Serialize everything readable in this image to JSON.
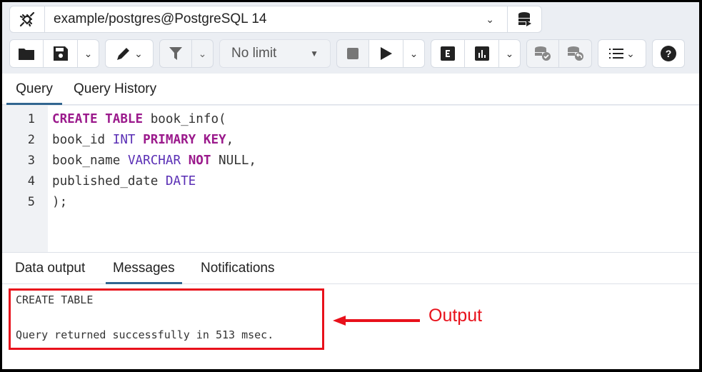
{
  "connection": {
    "label": "example/postgres@PostgreSQL 14",
    "icons": {
      "connection": "plug-disconnect-icon",
      "dropdown": "chevron-down-icon",
      "server": "database-execute-icon"
    }
  },
  "toolbar": {
    "buttons": [
      {
        "name": "open-file",
        "icon": "folder-icon"
      },
      {
        "name": "save-file",
        "icon": "save-icon"
      },
      {
        "name": "save-options",
        "icon": "chevron-down-icon"
      },
      {
        "name": "edit",
        "icon": "pencil-icon"
      },
      {
        "name": "filter",
        "icon": "filter-icon"
      },
      {
        "name": "filter-options",
        "icon": "chevron-down-icon"
      },
      {
        "name": "stop",
        "icon": "stop-icon"
      },
      {
        "name": "execute",
        "icon": "play-icon"
      },
      {
        "name": "execute-options",
        "icon": "chevron-down-icon"
      },
      {
        "name": "explain",
        "icon": "explain-icon"
      },
      {
        "name": "explain-analyze",
        "icon": "chart-icon"
      },
      {
        "name": "explain-options",
        "icon": "chevron-down-icon"
      },
      {
        "name": "commit",
        "icon": "database-commit-icon"
      },
      {
        "name": "rollback",
        "icon": "database-rollback-icon"
      },
      {
        "name": "macros",
        "icon": "list-ordered-icon"
      },
      {
        "name": "help",
        "icon": "help-icon"
      }
    ],
    "limit": {
      "selected": "No limit"
    }
  },
  "query_tabs": [
    {
      "label": "Query",
      "active": true
    },
    {
      "label": "Query History",
      "active": false
    }
  ],
  "editor": {
    "lines": [
      {
        "number": "1",
        "tokens": [
          {
            "t": "CREATE TABLE",
            "c": "kw"
          },
          {
            "t": " book_info(",
            "c": ""
          }
        ]
      },
      {
        "number": "2",
        "tokens": [
          {
            "t": "book_id ",
            "c": ""
          },
          {
            "t": "INT",
            "c": "ty"
          },
          {
            "t": " ",
            "c": ""
          },
          {
            "t": "PRIMARY KEY",
            "c": "kw"
          },
          {
            "t": ",",
            "c": ""
          }
        ]
      },
      {
        "number": "3",
        "tokens": [
          {
            "t": "book_name ",
            "c": ""
          },
          {
            "t": "VARCHAR",
            "c": "ty"
          },
          {
            "t": " ",
            "c": ""
          },
          {
            "t": "NOT",
            "c": "kw"
          },
          {
            "t": " NULL,",
            "c": ""
          }
        ]
      },
      {
        "number": "4",
        "tokens": [
          {
            "t": "published_date ",
            "c": ""
          },
          {
            "t": "DATE",
            "c": "ty"
          }
        ]
      },
      {
        "number": "5",
        "tokens": [
          {
            "t": ");",
            "c": ""
          }
        ]
      }
    ]
  },
  "output_tabs": [
    {
      "label": "Data output",
      "active": false
    },
    {
      "label": "Messages",
      "active": true
    },
    {
      "label": "Notifications",
      "active": false
    }
  ],
  "messages": {
    "line1": "CREATE TABLE",
    "line2": "Query returned successfully in 513 msec."
  },
  "annotation": {
    "label": "Output",
    "color": "#e8111b"
  }
}
